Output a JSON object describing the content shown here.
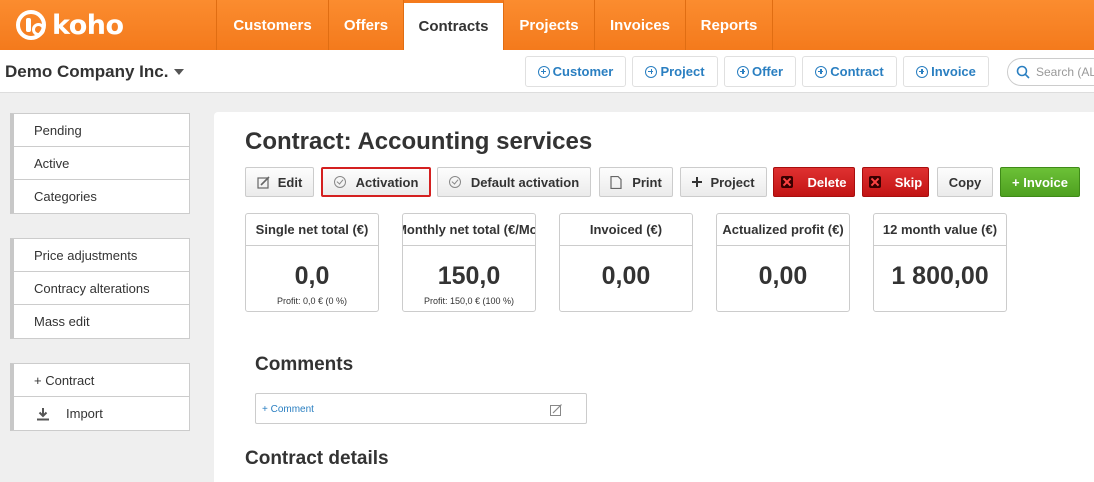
{
  "brand": {
    "logo_text": "koho",
    "accent": "#f47a1c"
  },
  "nav": {
    "tabs": [
      {
        "label": "Customers",
        "active": false
      },
      {
        "label": "Offers",
        "active": false
      },
      {
        "label": "Contracts",
        "active": true
      },
      {
        "label": "Projects",
        "active": false
      },
      {
        "label": "Invoices",
        "active": false
      },
      {
        "label": "Reports",
        "active": false
      }
    ]
  },
  "subbar": {
    "company": "Demo Company Inc.",
    "quick_add": [
      "Customer",
      "Project",
      "Offer",
      "Contract",
      "Invoice"
    ],
    "search_placeholder": "Search (ALT+S)"
  },
  "sidebar": {
    "group1": [
      "Pending",
      "Active",
      "Categories"
    ],
    "group2": [
      "Price adjustments",
      "Contracy alterations",
      "Mass edit"
    ],
    "group3": [
      "+ Contract",
      "Import"
    ]
  },
  "main": {
    "title": "Contract: Accounting services",
    "buttons": {
      "edit": "Edit",
      "activation": "Activation",
      "default_activation": "Default activation",
      "print": "Print",
      "project": "Project",
      "delete": "Delete",
      "skip": "Skip",
      "copy": "Copy",
      "invoice": "+ Invoice"
    },
    "stats": [
      {
        "label": "Single net total (€)",
        "value": "0,0",
        "sub": "Profit: 0,0 € (0 %)"
      },
      {
        "label": "Monthly net total (€/Mo)",
        "value": "150,0",
        "sub": "Profit: 150,0 € (100 %)"
      },
      {
        "label": "Invoiced (€)",
        "value": "0,00",
        "sub": ""
      },
      {
        "label": "Actualized profit (€)",
        "value": "0,00",
        "sub": ""
      },
      {
        "label": "12 month value (€)",
        "value": "1 800,00",
        "sub": ""
      }
    ],
    "comments_title": "Comments",
    "comment_link": "+ Comment",
    "details_title": "Contract details"
  }
}
